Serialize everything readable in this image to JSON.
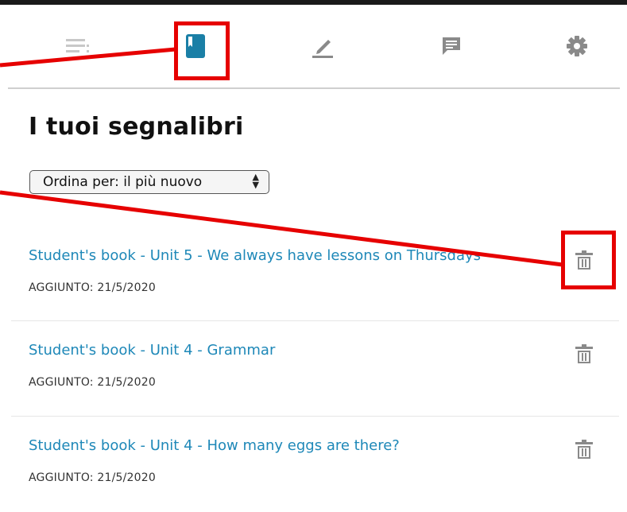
{
  "toolbar": {
    "icons": [
      "table-of-contents-icon",
      "bookmark-icon",
      "pen-icon",
      "note-icon",
      "gear-icon"
    ]
  },
  "page": {
    "title": "I tuoi segnalibri"
  },
  "sort": {
    "label": "Ordina per: il più nuovo"
  },
  "bookmarks": [
    {
      "title": "Student's book - Unit 5 - We always have lessons on Thursdays",
      "date": "AGGIUNTO: 21/5/2020"
    },
    {
      "title": "Student's book - Unit 4 - Grammar",
      "date": "AGGIUNTO: 21/5/2020"
    },
    {
      "title": "Student's book - Unit 4 - How many eggs are there?",
      "date": "AGGIUNTO: 21/5/2020"
    }
  ],
  "colors": {
    "accent": "#1e88b8",
    "annotation": "#e60000",
    "icon_gray": "#8a8a8a"
  }
}
